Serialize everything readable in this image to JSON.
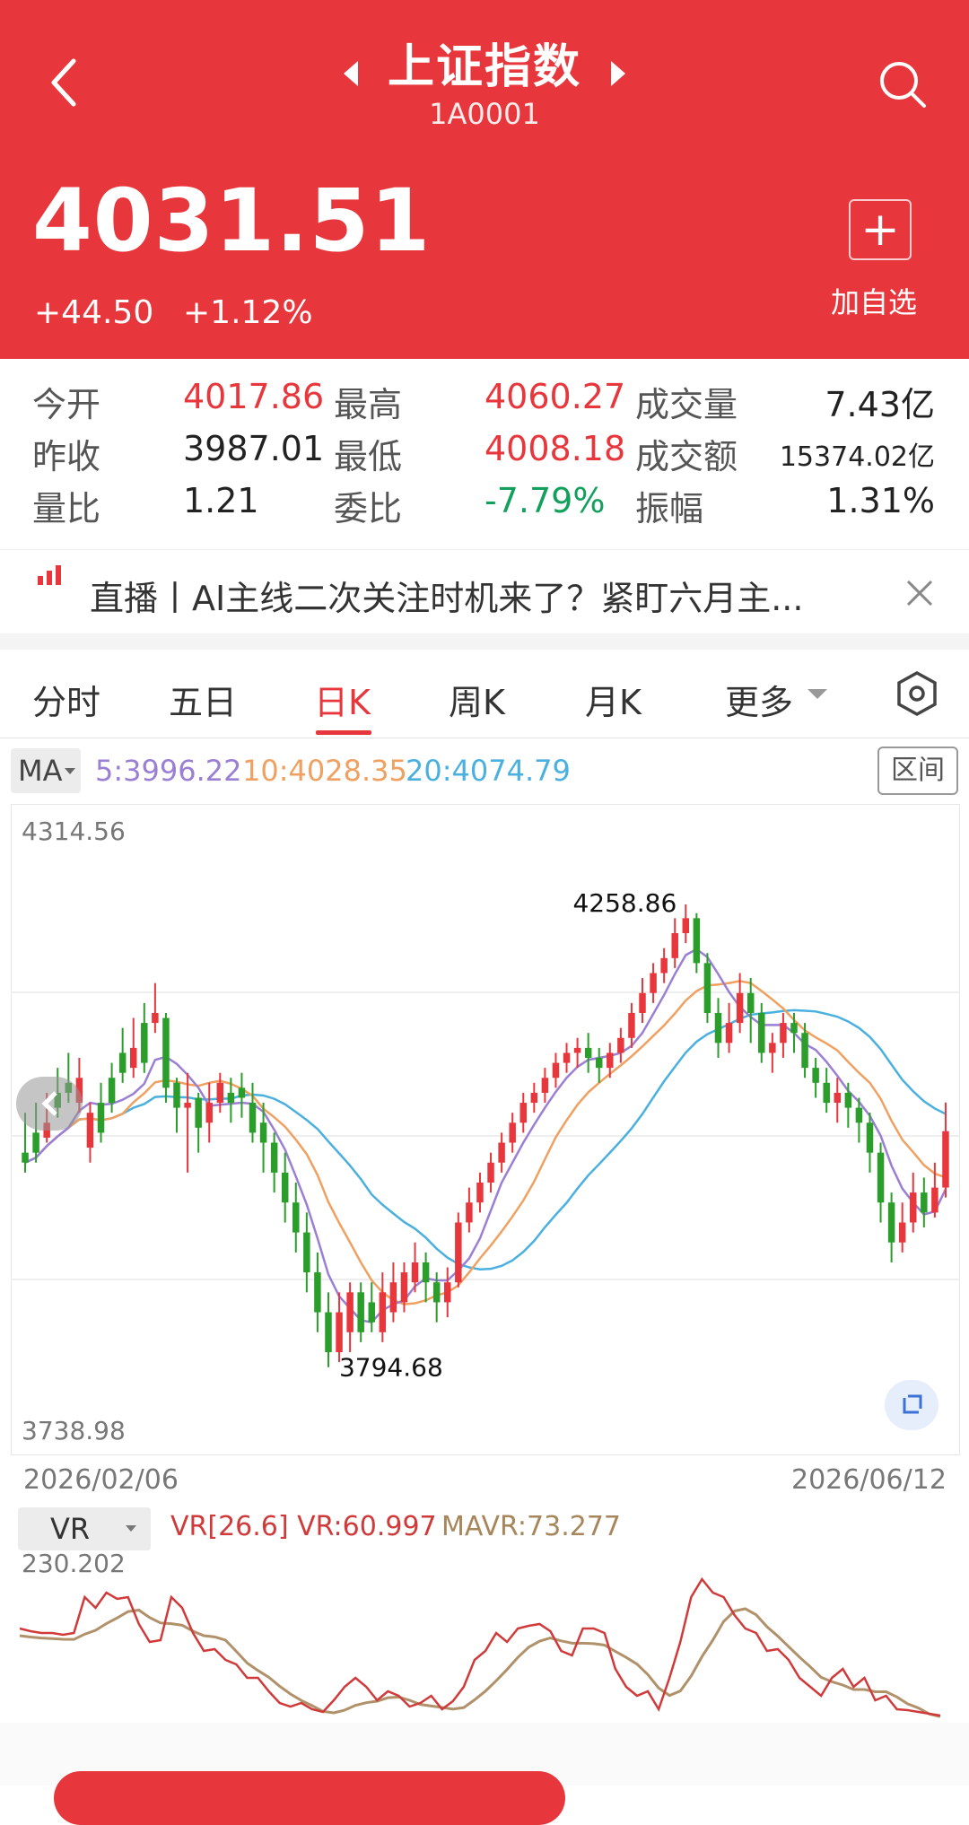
{
  "header": {
    "title": "上证指数",
    "code": "1A0001",
    "price": "4031.51",
    "change": "+44.50",
    "change_pct": "+1.12%",
    "add_label": "加自选",
    "bg_color": "#e8373c"
  },
  "stats": [
    {
      "label": "今开",
      "value": "4017.86",
      "color": "red"
    },
    {
      "label": "最高",
      "value": "4060.27",
      "color": "red"
    },
    {
      "label": "成交量",
      "value": "7.43亿",
      "color": "black"
    },
    {
      "label": "昨收",
      "value": "3987.01",
      "color": "black"
    },
    {
      "label": "最低",
      "value": "4008.18",
      "color": "red"
    },
    {
      "label": "成交额",
      "value": "15374.02亿",
      "color": "black"
    },
    {
      "label": "量比",
      "value": "1.21",
      "color": "black"
    },
    {
      "label": "委比",
      "value": "-7.79%",
      "color": "green"
    },
    {
      "label": "振幅",
      "value": "1.31%",
      "color": "black"
    }
  ],
  "news": {
    "text": "直播丨AI主线二次关注时机来了？紧盯六月主..."
  },
  "tabs": [
    {
      "label": "分时"
    },
    {
      "label": "五日"
    },
    {
      "label": "日K",
      "active": true
    },
    {
      "label": "周K"
    },
    {
      "label": "月K"
    },
    {
      "label": "更多"
    }
  ],
  "ma": {
    "selector": "MA",
    "ma5": "5:3996.22",
    "ma10": "10:4028.35",
    "ma20": "20:4074.79",
    "range_label": "区间",
    "colors": {
      "ma5": "#9b7fd4",
      "ma10": "#f0a060",
      "ma20": "#4ab0e0"
    }
  },
  "chart_data": {
    "type": "candlestick",
    "y_max_label": "4314.56",
    "y_min_label": "3738.98",
    "x_start": "2026/02/06",
    "x_end": "2026/06/12",
    "high_annotation": "4258.86",
    "low_annotation": "3794.68",
    "ylim": [
      3738.98,
      4314.56
    ],
    "up_color": "#e8373c",
    "down_color": "#2a9d2a",
    "candles": [
      [
        4010,
        4000,
        4050,
        3990
      ],
      [
        4030,
        4010,
        4060,
        4000
      ],
      [
        4025,
        4040,
        4070,
        4020
      ],
      [
        4070,
        4055,
        4095,
        4045
      ],
      [
        4080,
        4070,
        4110,
        4060
      ],
      [
        4060,
        4085,
        4105,
        4050
      ],
      [
        4015,
        4050,
        4060,
        4000
      ],
      [
        4060,
        4030,
        4080,
        4020
      ],
      [
        4085,
        4060,
        4100,
        4050
      ],
      [
        4110,
        4090,
        4135,
        4080
      ],
      [
        4095,
        4115,
        4145,
        4085
      ],
      [
        4140,
        4100,
        4160,
        4090
      ],
      [
        4140,
        4150,
        4180,
        4130
      ],
      [
        4145,
        4075,
        4150,
        4060
      ],
      [
        4080,
        4055,
        4085,
        4030
      ],
      [
        4055,
        4060,
        4090,
        3990
      ],
      [
        4065,
        4035,
        4070,
        4010
      ],
      [
        4040,
        4060,
        4080,
        4020
      ],
      [
        4060,
        4080,
        4090,
        4050
      ],
      [
        4070,
        4060,
        4085,
        4040
      ],
      [
        4075,
        4065,
        4090,
        4045
      ],
      [
        4060,
        4030,
        4080,
        4020
      ],
      [
        4040,
        4020,
        4060,
        3990
      ],
      [
        4020,
        3990,
        4030,
        3970
      ],
      [
        3990,
        3960,
        4010,
        3940
      ],
      [
        3960,
        3930,
        3980,
        3910
      ],
      [
        3930,
        3890,
        3950,
        3870
      ],
      [
        3890,
        3850,
        3910,
        3830
      ],
      [
        3850,
        3810,
        3870,
        3795
      ],
      [
        3810,
        3850,
        3870,
        3800
      ],
      [
        3830,
        3870,
        3880,
        3810
      ],
      [
        3870,
        3830,
        3880,
        3820
      ],
      [
        3860,
        3840,
        3880,
        3830
      ],
      [
        3830,
        3870,
        3890,
        3820
      ],
      [
        3850,
        3880,
        3900,
        3840
      ],
      [
        3860,
        3890,
        3900,
        3850
      ],
      [
        3880,
        3900,
        3920,
        3870
      ],
      [
        3900,
        3880,
        3910,
        3860
      ],
      [
        3880,
        3860,
        3890,
        3840
      ],
      [
        3860,
        3880,
        3895,
        3845
      ],
      [
        3880,
        3940,
        3950,
        3875
      ],
      [
        3940,
        3960,
        3975,
        3930
      ],
      [
        3960,
        3980,
        3990,
        3950
      ],
      [
        3980,
        4000,
        4010,
        3970
      ],
      [
        4000,
        4020,
        4030,
        3990
      ],
      [
        4020,
        4040,
        4050,
        4010
      ],
      [
        4040,
        4060,
        4070,
        4030
      ],
      [
        4060,
        4070,
        4080,
        4050
      ],
      [
        4070,
        4085,
        4095,
        4060
      ],
      [
        4085,
        4100,
        4110,
        4075
      ],
      [
        4100,
        4110,
        4120,
        4090
      ],
      [
        4110,
        4115,
        4125,
        4095
      ],
      [
        4115,
        4105,
        4130,
        4090
      ],
      [
        4105,
        4095,
        4115,
        4080
      ],
      [
        4095,
        4110,
        4120,
        4085
      ],
      [
        4110,
        4125,
        4135,
        4100
      ],
      [
        4125,
        4150,
        4160,
        4115
      ],
      [
        4150,
        4170,
        4185,
        4140
      ],
      [
        4170,
        4190,
        4200,
        4160
      ],
      [
        4190,
        4205,
        4215,
        4180
      ],
      [
        4205,
        4230,
        4245,
        4195
      ],
      [
        4230,
        4245,
        4258.86,
        4220
      ],
      [
        4245,
        4200,
        4250,
        4190
      ],
      [
        4200,
        4150,
        4210,
        4140
      ],
      [
        4150,
        4120,
        4165,
        4105
      ],
      [
        4120,
        4140,
        4160,
        4110
      ],
      [
        4140,
        4170,
        4190,
        4130
      ],
      [
        4170,
        4150,
        4185,
        4120
      ],
      [
        4150,
        4110,
        4160,
        4100
      ],
      [
        4110,
        4120,
        4130,
        4090
      ],
      [
        4120,
        4140,
        4150,
        4105
      ],
      [
        4140,
        4130,
        4150,
        4110
      ],
      [
        4130,
        4095,
        4140,
        4085
      ],
      [
        4095,
        4080,
        4105,
        4065
      ],
      [
        4080,
        4060,
        4095,
        4050
      ],
      [
        4060,
        4070,
        4085,
        4040
      ],
      [
        4070,
        4055,
        4080,
        4035
      ],
      [
        4055,
        4040,
        4065,
        4020
      ],
      [
        4040,
        4010,
        4050,
        3990
      ],
      [
        4010,
        3960,
        4020,
        3940
      ],
      [
        3960,
        3920,
        3970,
        3900
      ],
      [
        3920,
        3940,
        3960,
        3910
      ],
      [
        3940,
        3970,
        3990,
        3930
      ],
      [
        3970,
        3950,
        3985,
        3935
      ],
      [
        3950,
        3975,
        4000,
        3945
      ],
      [
        3975,
        4031.51,
        4060.27,
        3965
      ]
    ]
  },
  "vr": {
    "selector": "VR",
    "label1": "VR[26.6] VR:60.997",
    "label2": "MAVR:73.277",
    "max_label": "230.202",
    "color1": "#d03a3a",
    "color2": "#b0916a"
  }
}
